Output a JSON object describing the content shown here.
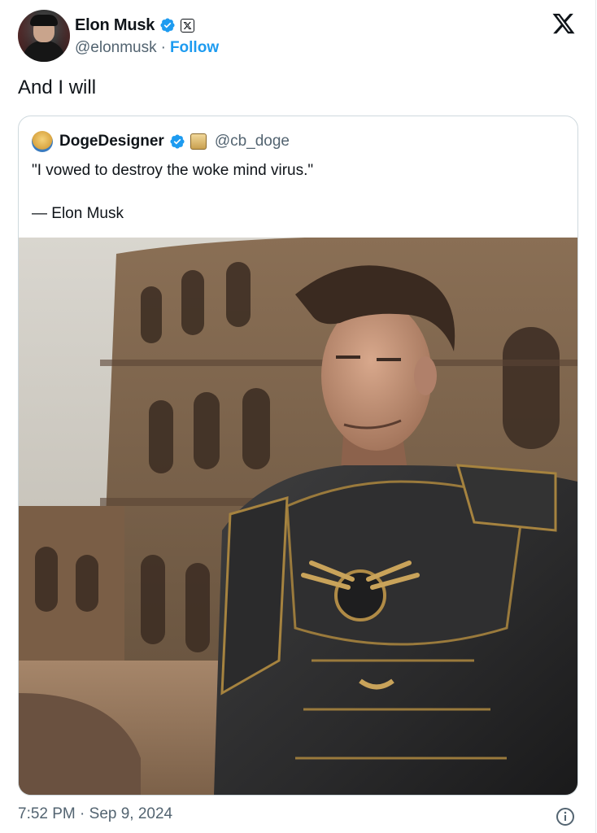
{
  "author": {
    "name": "Elon Musk",
    "handle": "@elonmusk",
    "separator": "·",
    "follow_label": "Follow",
    "avatar_icon": "avatar-photo",
    "verified_icon": "verified-badge-icon",
    "affiliate_icon": "x-affiliate-badge-icon"
  },
  "brand": {
    "logo_icon": "x-logo-icon",
    "accent": "#1d9bf0"
  },
  "tweet": {
    "text": "And I will"
  },
  "quote": {
    "author_name": "DogeDesigner",
    "author_handle": "@cb_doge",
    "line1": "\"I vowed to destroy the woke mind virus.\"",
    "line2": "— Elon Musk",
    "image_icon": "attached-image"
  },
  "footer": {
    "timestamp": "7:52 PM · Sep 9, 2024",
    "info_icon": "info-icon"
  }
}
